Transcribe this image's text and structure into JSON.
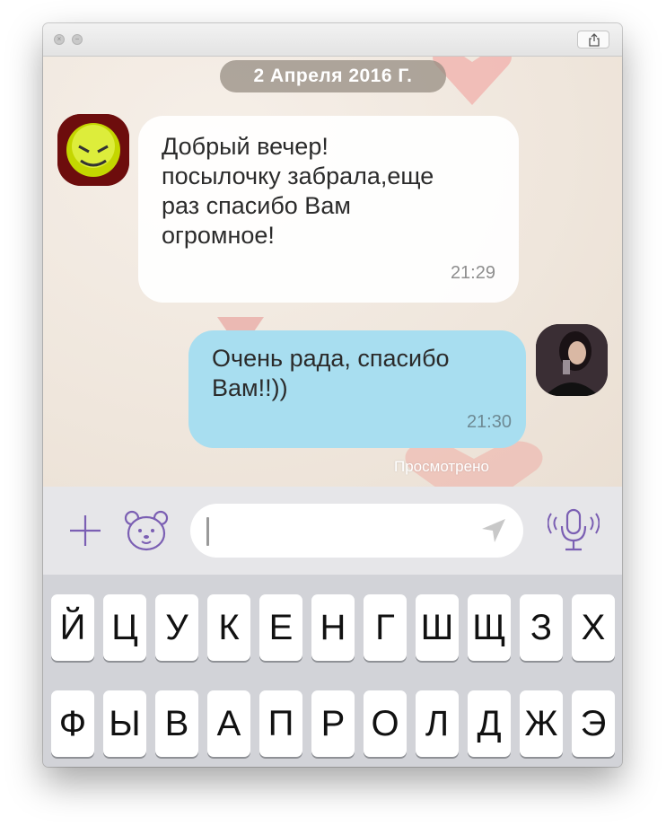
{
  "window": {
    "close_glyph": "×",
    "minimize_glyph": "−"
  },
  "chat": {
    "date": "2 Апреля 2016 Г.",
    "messages": [
      {
        "direction": "incoming",
        "lines": [
          "Добрый вечер!",
          "посылочку забрала,еще",
          "раз спасибо Вам",
          "огромное!"
        ],
        "time": "21:29"
      },
      {
        "direction": "outgoing",
        "lines": [
          "Очень рада, спасибо",
          "Вам!!))"
        ],
        "time": "21:30"
      }
    ],
    "seen_status": "Просмотрено"
  },
  "input": {
    "value": "",
    "placeholder": "",
    "icons": [
      "plus-icon",
      "sticker-bear-icon",
      "send-arrow-icon",
      "microphone-icon"
    ]
  },
  "keyboard": {
    "rows": [
      [
        "Й",
        "Ц",
        "У",
        "К",
        "Е",
        "Н",
        "Г",
        "Ш",
        "Щ",
        "З",
        "Х"
      ],
      [
        "Ф",
        "Ы",
        "В",
        "А",
        "П",
        "Р",
        "О",
        "Л",
        "Д",
        "Ж",
        "Э"
      ]
    ]
  },
  "colors": {
    "accent_purple": "#7b5fb3",
    "outgoing_bubble": "#a8def0",
    "incoming_bubble": "#ffffff"
  }
}
